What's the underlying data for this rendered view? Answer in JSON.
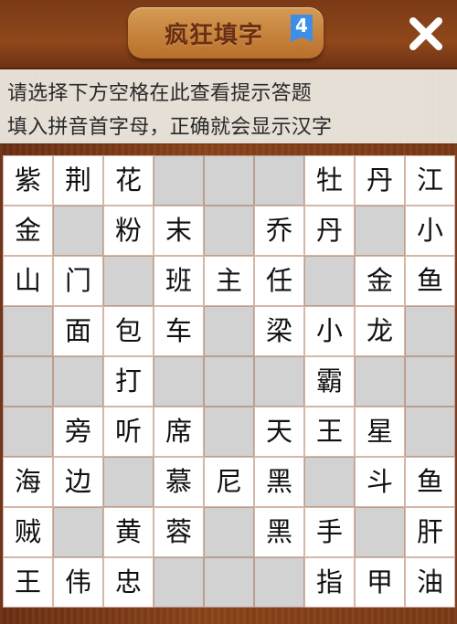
{
  "header": {
    "logo_text": "疯狂填字",
    "level_badge": "4",
    "close_icon": "close-x-icon"
  },
  "hints": {
    "line1": "请选择下方空格在此查看提示答题",
    "line2": "填入拼音首字母，正确就会显示汉字"
  },
  "grid": {
    "rows": [
      [
        {
          "text": "紫",
          "type": "white"
        },
        {
          "text": "荆",
          "type": "white"
        },
        {
          "text": "花",
          "type": "white"
        },
        {
          "text": "",
          "type": "gray"
        },
        {
          "text": "",
          "type": "gray"
        },
        {
          "text": "",
          "type": "gray"
        },
        {
          "text": "牡",
          "type": "white"
        },
        {
          "text": "丹",
          "type": "white"
        },
        {
          "text": "江",
          "type": "white"
        }
      ],
      [
        {
          "text": "金",
          "type": "white"
        },
        {
          "text": "",
          "type": "gray"
        },
        {
          "text": "粉",
          "type": "white"
        },
        {
          "text": "末",
          "type": "white"
        },
        {
          "text": "",
          "type": "gray"
        },
        {
          "text": "乔",
          "type": "white"
        },
        {
          "text": "丹",
          "type": "white"
        },
        {
          "text": "",
          "type": "gray"
        },
        {
          "text": "小",
          "type": "white"
        }
      ],
      [
        {
          "text": "山",
          "type": "white"
        },
        {
          "text": "门",
          "type": "white"
        },
        {
          "text": "",
          "type": "gray"
        },
        {
          "text": "班",
          "type": "white"
        },
        {
          "text": "主",
          "type": "white"
        },
        {
          "text": "任",
          "type": "white"
        },
        {
          "text": "",
          "type": "gray"
        },
        {
          "text": "金",
          "type": "white"
        },
        {
          "text": "鱼",
          "type": "white"
        }
      ],
      [
        {
          "text": "",
          "type": "gray"
        },
        {
          "text": "面",
          "type": "white"
        },
        {
          "text": "包",
          "type": "white"
        },
        {
          "text": "车",
          "type": "white"
        },
        {
          "text": "",
          "type": "gray"
        },
        {
          "text": "梁",
          "type": "white"
        },
        {
          "text": "小",
          "type": "white"
        },
        {
          "text": "龙",
          "type": "white"
        },
        {
          "text": "",
          "type": "gray"
        }
      ],
      [
        {
          "text": "",
          "type": "gray"
        },
        {
          "text": "",
          "type": "gray"
        },
        {
          "text": "打",
          "type": "white"
        },
        {
          "text": "",
          "type": "gray"
        },
        {
          "text": "",
          "type": "gray"
        },
        {
          "text": "",
          "type": "gray"
        },
        {
          "text": "霸",
          "type": "white"
        },
        {
          "text": "",
          "type": "gray"
        },
        {
          "text": "",
          "type": "gray"
        }
      ],
      [
        {
          "text": "",
          "type": "gray"
        },
        {
          "text": "旁",
          "type": "white"
        },
        {
          "text": "听",
          "type": "white"
        },
        {
          "text": "席",
          "type": "white"
        },
        {
          "text": "",
          "type": "gray"
        },
        {
          "text": "天",
          "type": "white"
        },
        {
          "text": "王",
          "type": "white"
        },
        {
          "text": "星",
          "type": "white"
        },
        {
          "text": "",
          "type": "gray"
        }
      ],
      [
        {
          "text": "海",
          "type": "white"
        },
        {
          "text": "边",
          "type": "white"
        },
        {
          "text": "",
          "type": "gray"
        },
        {
          "text": "慕",
          "type": "white"
        },
        {
          "text": "尼",
          "type": "white"
        },
        {
          "text": "黑",
          "type": "white"
        },
        {
          "text": "",
          "type": "gray"
        },
        {
          "text": "斗",
          "type": "white"
        },
        {
          "text": "鱼",
          "type": "white"
        }
      ],
      [
        {
          "text": "贼",
          "type": "white"
        },
        {
          "text": "",
          "type": "gray"
        },
        {
          "text": "黄",
          "type": "white"
        },
        {
          "text": "蓉",
          "type": "white"
        },
        {
          "text": "",
          "type": "gray"
        },
        {
          "text": "黑",
          "type": "white"
        },
        {
          "text": "手",
          "type": "white"
        },
        {
          "text": "",
          "type": "gray"
        },
        {
          "text": "肝",
          "type": "white"
        }
      ],
      [
        {
          "text": "王",
          "type": "white"
        },
        {
          "text": "伟",
          "type": "white"
        },
        {
          "text": "忠",
          "type": "white"
        },
        {
          "text": "",
          "type": "gray"
        },
        {
          "text": "",
          "type": "gray"
        },
        {
          "text": "",
          "type": "gray"
        },
        {
          "text": "指",
          "type": "white"
        },
        {
          "text": "甲",
          "type": "white"
        },
        {
          "text": "油",
          "type": "white"
        }
      ]
    ]
  }
}
